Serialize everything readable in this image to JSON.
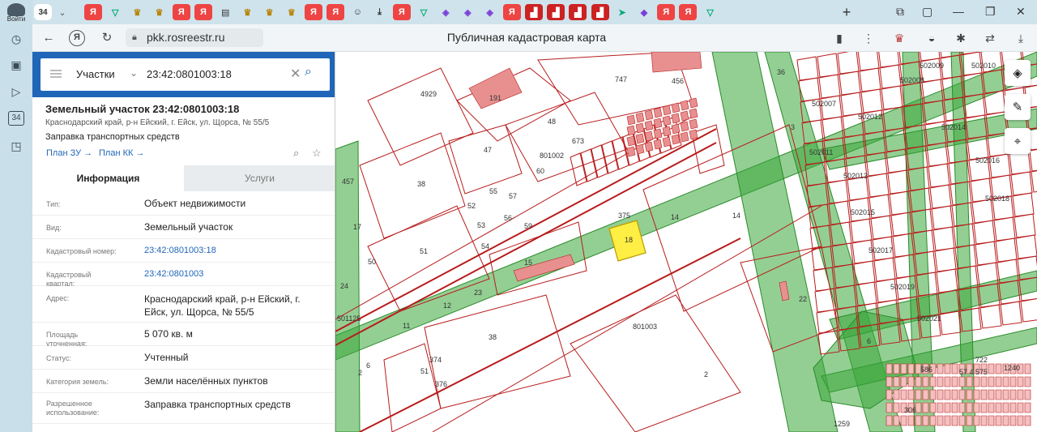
{
  "rail": {
    "login_label": "Войти",
    "tab_counter": "34"
  },
  "tabs": {
    "active_counter": "34",
    "items": [
      {
        "kind": "ya",
        "glyph": "Я"
      },
      {
        "kind": "gos",
        "glyph": "▽"
      },
      {
        "kind": "eagle",
        "glyph": "♛"
      },
      {
        "kind": "eagle",
        "glyph": "♛"
      },
      {
        "kind": "ya",
        "glyph": "Я"
      },
      {
        "kind": "ya",
        "glyph": "Я"
      },
      {
        "kind": "doc",
        "glyph": "▤"
      },
      {
        "kind": "eagle",
        "glyph": "♛"
      },
      {
        "kind": "eagle",
        "glyph": "♛"
      },
      {
        "kind": "eagle",
        "glyph": "♛"
      },
      {
        "kind": "ya",
        "glyph": "Я"
      },
      {
        "kind": "ya",
        "glyph": "Я"
      },
      {
        "kind": "dl",
        "glyph": "☺"
      },
      {
        "kind": "dl",
        "glyph": "⤓"
      },
      {
        "kind": "ya",
        "glyph": "Я"
      },
      {
        "kind": "gos",
        "glyph": "▽"
      },
      {
        "kind": "ext",
        "glyph": "◈"
      },
      {
        "kind": "ext",
        "glyph": "◈"
      },
      {
        "kind": "ext",
        "glyph": "◈"
      },
      {
        "kind": "ya",
        "glyph": "Я"
      },
      {
        "kind": "red",
        "glyph": "▟"
      },
      {
        "kind": "red",
        "glyph": "▟"
      },
      {
        "kind": "red",
        "glyph": "▟"
      },
      {
        "kind": "red",
        "glyph": "▟"
      },
      {
        "kind": "gos",
        "glyph": "➤"
      },
      {
        "kind": "ext",
        "glyph": "◆"
      },
      {
        "kind": "ya",
        "glyph": "Я"
      },
      {
        "kind": "ya",
        "glyph": "Я"
      },
      {
        "kind": "gos",
        "glyph": "▽"
      }
    ],
    "new_tab": "+"
  },
  "addressbar": {
    "url": "pkk.rosreestr.ru",
    "page_title": "Публичная кадастровая карта"
  },
  "search": {
    "type_label": "Участки",
    "query": "23:42:0801003:18"
  },
  "object": {
    "title": "Земельный участок 23:42:0801003:18",
    "address_line": "Краснодарский край, р-н Ейский, г. Ейск, ул. Щорса, № 55/5",
    "use": "Заправка транспортных средств",
    "plan_zu": "План ЗУ →",
    "plan_kk": "План КК →"
  },
  "panel_tabs": {
    "info": "Информация",
    "services": "Услуги"
  },
  "attributes": [
    {
      "label": "Тип:",
      "value": "Объект недвижимости",
      "link": false
    },
    {
      "label": "Вид:",
      "value": "Земельный участок",
      "link": false
    },
    {
      "label": "Кадастровый номер:",
      "value": "23:42:0801003:18",
      "link": true
    },
    {
      "label": "Кадастровый квартал:",
      "value": "23:42:0801003",
      "link": true
    },
    {
      "label": "Адрес:",
      "value": "Краснодарский край, р-н Ейский, г. Ейск, ул. Щорса, № 55/5",
      "link": false
    },
    {
      "label": "Площадь уточненная:",
      "value": "5 070 кв. м",
      "link": false
    },
    {
      "label": "Статус:",
      "value": "Учтенный",
      "link": false
    },
    {
      "label": "Категория земель:",
      "value": "Земли населённых пунктов",
      "link": false
    },
    {
      "label": "Разрешенное использование:",
      "value": "Заправка транспортных средств",
      "link": false
    }
  ],
  "map": {
    "labels": [
      "4929",
      "191",
      "747",
      "456",
      "48",
      "47",
      "801002",
      "673",
      "38",
      "60",
      "55",
      "52",
      "57",
      "56",
      "53",
      "59",
      "51",
      "54",
      "375",
      "18",
      "14",
      "14",
      "15",
      "22",
      "801003",
      "38",
      "12",
      "23",
      "11",
      "374",
      "51",
      "376",
      "6",
      "2",
      "457",
      "17",
      "24",
      "50",
      "501125",
      "2",
      "502009",
      "502010",
      "502008",
      "502007",
      "502012",
      "502011",
      "502014",
      "502013",
      "502016",
      "502018",
      "502015",
      "502017",
      "502019",
      "502021",
      "6",
      "1240",
      "57 4 575",
      "1259",
      "306",
      "36",
      "3",
      "586",
      "722"
    ],
    "colors": {
      "parcel": "#b81c1c",
      "road_fill": "#3aa83a",
      "highlight": "#ffee44"
    }
  }
}
